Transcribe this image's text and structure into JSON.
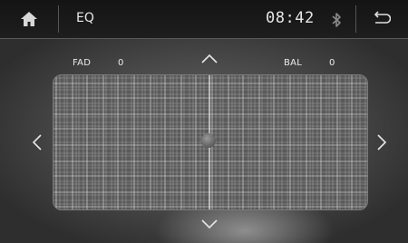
{
  "topbar": {
    "title": "EQ",
    "time": "08:42",
    "icons": [
      "home-icon",
      "bluetooth-icon",
      "back-icon"
    ]
  },
  "fader": {
    "label": "FAD",
    "value": "0"
  },
  "balance": {
    "label": "BAL",
    "value": "0"
  },
  "controls": [
    "arrow-up-icon",
    "arrow-down-icon",
    "arrow-left-icon",
    "arrow-right-icon"
  ],
  "colors": {
    "bar": "#1a1a1a",
    "text": "#e8e8e8",
    "grid": "#d8d8d8"
  }
}
